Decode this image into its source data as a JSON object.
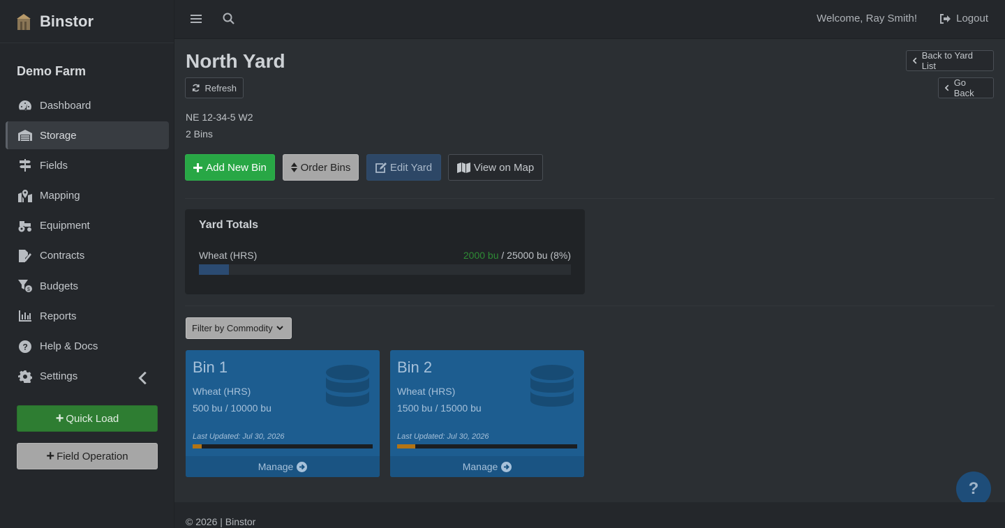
{
  "brand": {
    "name": "Binstor"
  },
  "sidebar": {
    "farm_name": "Demo Farm",
    "items": [
      {
        "label": "Dashboard",
        "icon": "tachometer-icon"
      },
      {
        "label": "Storage",
        "icon": "warehouse-icon",
        "active": true
      },
      {
        "label": "Fields",
        "icon": "signpost-icon"
      },
      {
        "label": "Mapping",
        "icon": "map-marker-icon"
      },
      {
        "label": "Equipment",
        "icon": "tractor-icon"
      },
      {
        "label": "Contracts",
        "icon": "file-signature-icon"
      },
      {
        "label": "Budgets",
        "icon": "budget-icon"
      },
      {
        "label": "Reports",
        "icon": "bar-chart-icon"
      },
      {
        "label": "Help & Docs",
        "icon": "question-circle-icon"
      },
      {
        "label": "Settings",
        "icon": "gear-icon"
      }
    ],
    "quick_load_label": "Quick Load",
    "field_operation_label": "Field Operation"
  },
  "topbar": {
    "welcome": "Welcome, Ray Smith!",
    "logout_label": "Logout"
  },
  "page": {
    "title": "North Yard",
    "refresh_label": "Refresh",
    "back_to_yard_list_label": "Back to Yard List",
    "go_back_label": "Go Back",
    "location": "NE 12-34-5 W2",
    "bin_count": "2 Bins",
    "actions": {
      "add_new_bin": "Add New Bin",
      "order_bins": "Order Bins",
      "edit_yard": "Edit Yard",
      "view_on_map": "View on Map"
    }
  },
  "yard_totals": {
    "title": "Yard Totals",
    "commodity": "Wheat (HRS)",
    "current": "2000 bu",
    "capacity_text": "/ 25000 bu (8%)",
    "fill_fraction": 0.08,
    "bar_color": "#2b4b72"
  },
  "filter": {
    "label": "Filter by Commodity"
  },
  "bins": [
    {
      "name": "Bin 1",
      "commodity": "Wheat (HRS)",
      "amount": "500 bu / 10000 bu",
      "last_updated": "Last Updated: Jul 30, 2026",
      "fill_fraction": 0.05,
      "manage_label": "Manage"
    },
    {
      "name": "Bin 2",
      "commodity": "Wheat (HRS)",
      "amount": "1500 bu / 15000 bu",
      "last_updated": "Last Updated: Jul 30, 2026",
      "fill_fraction": 0.1,
      "manage_label": "Manage"
    }
  ],
  "help_fab": {
    "label": "?"
  },
  "footer": {
    "text": "© 2026 | Binstor"
  },
  "colors": {
    "accent_green": "#28a745",
    "bin_card": "#1d5d90",
    "bin_fill": "#b27414"
  }
}
